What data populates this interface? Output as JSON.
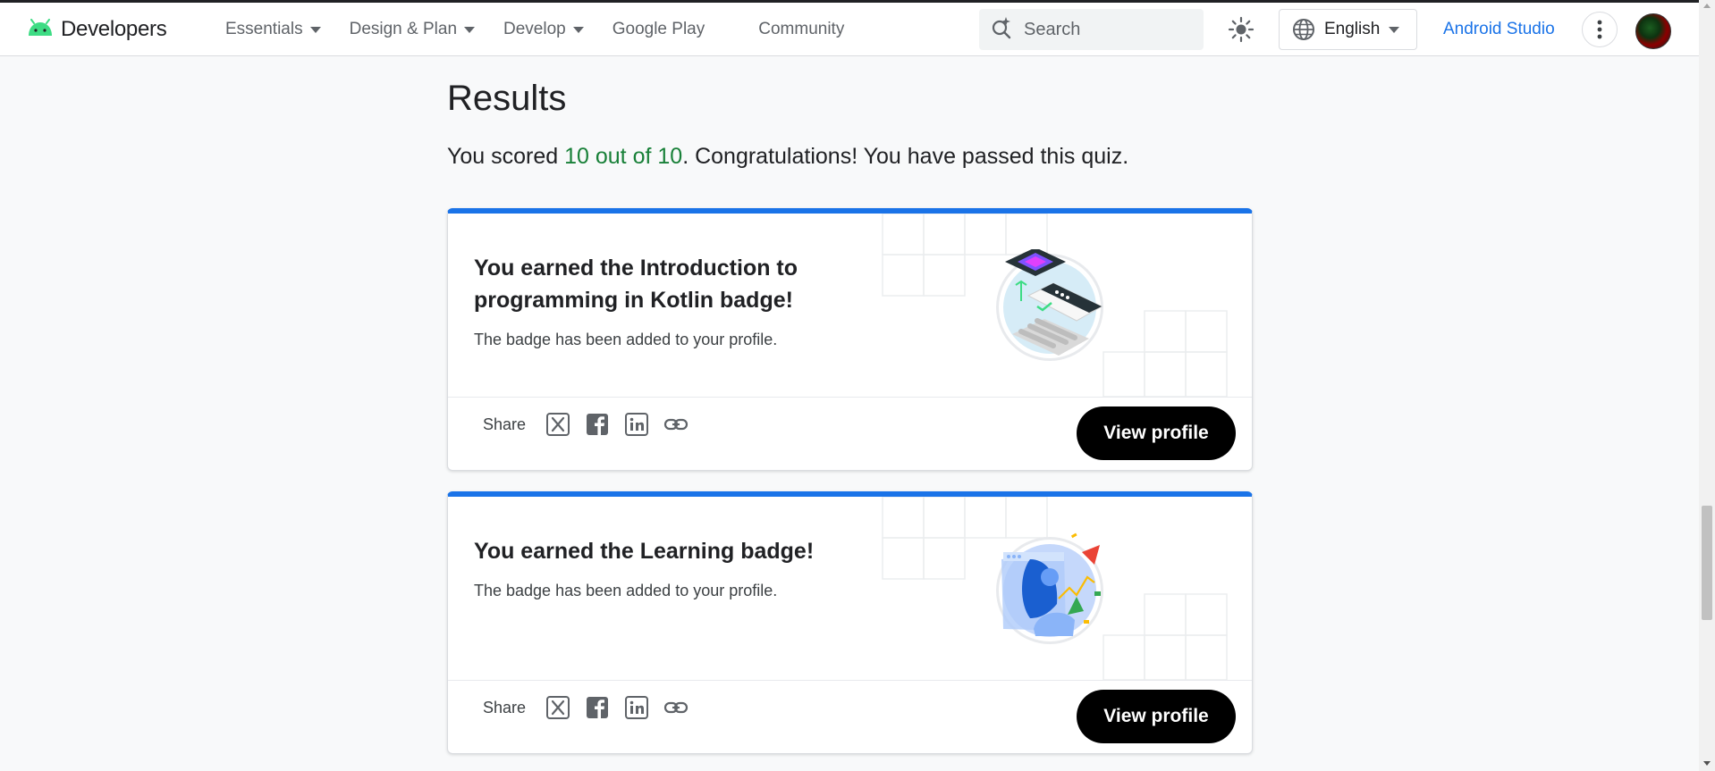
{
  "header": {
    "brand": "Developers",
    "nav": [
      {
        "label": "Essentials"
      },
      {
        "label": "Design & Plan"
      },
      {
        "label": "Develop"
      },
      {
        "label": "Google Play"
      },
      {
        "label": "Community"
      }
    ],
    "search_placeholder": "Search",
    "language": "English",
    "studio_link": "Android Studio"
  },
  "main": {
    "title": "Results",
    "score_prefix": "You scored ",
    "score_value": "10 out of 10",
    "score_suffix": ". Congratulations! You have passed this quiz."
  },
  "cards": [
    {
      "headline_pre": "You earned the ",
      "badge_name": "Introduction to programming in Kotlin",
      "headline_post": " badge!",
      "subtitle": "The badge has been added to your profile.",
      "share_label": "Share",
      "button_label": "View profile"
    },
    {
      "headline_pre": "You earned the ",
      "badge_name": "Learning",
      "headline_post": " badge!",
      "subtitle": "The badge has been added to your profile.",
      "share_label": "Share",
      "button_label": "View profile"
    }
  ],
  "colors": {
    "accent": "#1a73e8",
    "score_green": "#188038",
    "android_green": "#3ddc84",
    "button_black": "#000000"
  },
  "icons": {
    "logo": "android-head-icon",
    "nav_caret": "caret-down-icon",
    "search": "search-spark-icon",
    "theme": "sun-icon",
    "language": "globe-icon",
    "more": "more-vert-icon",
    "share": [
      "x-twitter-icon",
      "facebook-icon",
      "linkedin-icon",
      "link-icon"
    ]
  }
}
